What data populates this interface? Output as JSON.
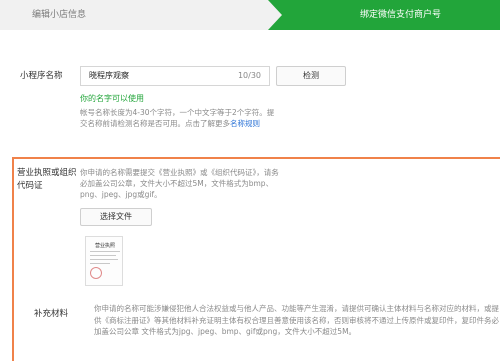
{
  "steps": {
    "step1": "编辑小店信息",
    "step2": "绑定微信支付商户号"
  },
  "mini_program_name": {
    "label": "小程序名称",
    "value": "晓程序观察",
    "count": "10/30",
    "check_button": "检测",
    "status": "你的名字可以使用",
    "hint": "帐号名称长度为4-30个字符，一个中文字等于2个字符。提交名称前请检测名称是否可用。点击了解更多",
    "hint_link": "名称规则"
  },
  "qualification": {
    "label": "营业执照或组织代码证",
    "hint": "你申请的名称需要提交《营业执照》或《组织代码证》，请务必加盖公司公章，文件大小不超过5M，文件格式为bmp、png、jpeg、jpg或gif。",
    "upload_button": "选择文件",
    "thumb_title": "营业执照"
  },
  "supplement": {
    "label": "补充材料",
    "hint": "你申请的名称可能涉嫌侵犯他人合法权益或与他人产品、功能等产生混淆，请提供可确认主体材料与名称对应的材料，或提供《商标注册证》等其他材料补充证明主体有权合理且善意使用该名称，否则审核将不通过上传原件或复印件，复印件务必加盖公司公章 文件格式为jpg、jpeg、bmp、gif或png，文件大小不超过5M。"
  }
}
